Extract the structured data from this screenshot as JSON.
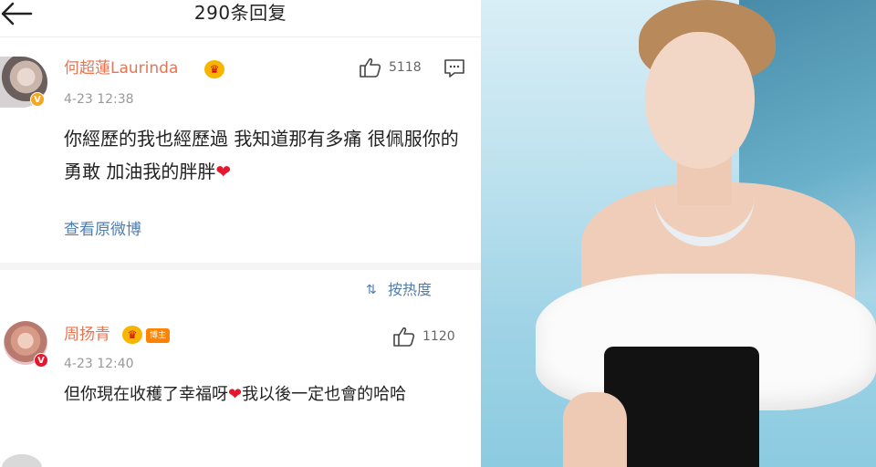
{
  "header": {
    "title": "290条回复",
    "back_icon": "arrow-left-icon"
  },
  "comments": [
    {
      "username": "何超蓮Laurinda",
      "badge_icon": "crown-icon",
      "verified_icon": "v-verified-icon",
      "timestamp": "4-23 12:38",
      "likes": "5118",
      "text_before_heart": "你經歷的我也經歷過 我知道那有多痛 很佩服你的勇敢 加油我的胖胖",
      "heart": "❤",
      "text_after_heart": "",
      "view_original": "查看原微博"
    },
    {
      "username": "周扬青",
      "badge_icon": "crown-icon",
      "fan_badge": "博主",
      "timestamp": "4-23 12:40",
      "likes": "1120",
      "text_before_heart": "但你現在收穫了幸福呀",
      "heart": "❤",
      "text_after_heart": "我以後一定也會的哈哈"
    }
  ],
  "sort": {
    "label": "按热度",
    "icon": "sort-icon"
  },
  "colors": {
    "username": "#eb7350",
    "link": "#507daf",
    "timestamp": "#999999",
    "heart": "#e6162d"
  }
}
